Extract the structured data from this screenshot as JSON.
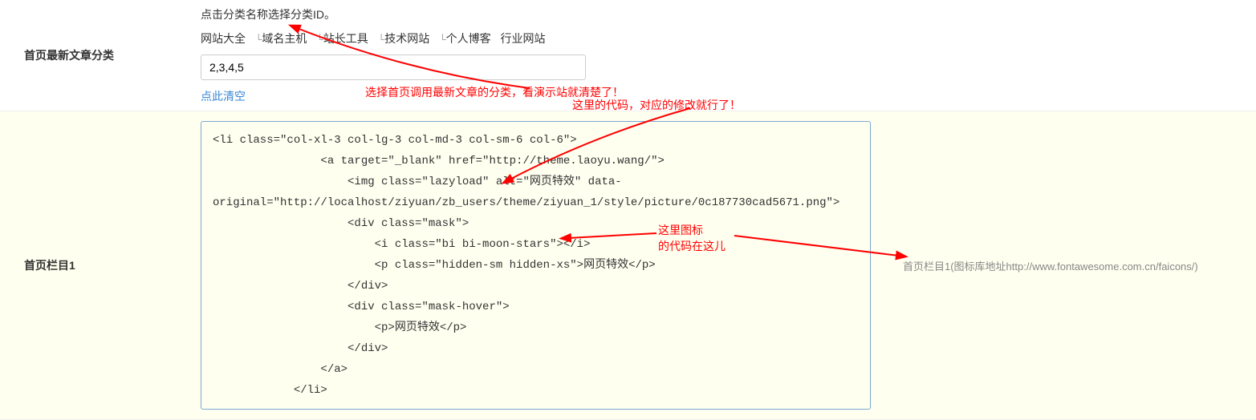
{
  "section1": {
    "label": "首页最新文章分类",
    "hint": "点击分类名称选择分类ID。",
    "categories": [
      {
        "prefix": "",
        "name": "网站大全"
      },
      {
        "prefix": "└",
        "name": "域名主机"
      },
      {
        "prefix": "└",
        "name": "站长工具"
      },
      {
        "prefix": "└",
        "name": "技术网站"
      },
      {
        "prefix": "└",
        "name": "个人博客"
      },
      {
        "prefix": "",
        "name": "行业网站"
      }
    ],
    "input_value": "2,3,4,5",
    "clear_text": "点此清空",
    "annotation1": "选择首页调用最新文章的分类，看演示站就清楚了！"
  },
  "section2": {
    "label": "首页栏目1",
    "right_note": "首页栏目1(图标库地址http://www.fontawesome.com.cn/faicons/)",
    "code": "<li class=\"col-xl-3 col-lg-3 col-md-3 col-sm-6 col-6\">\n                <a target=\"_blank\" href=\"http://theme.laoyu.wang/\">\n                    <img class=\"lazyload\" alt=\"网页特效\" data-\noriginal=\"http://localhost/ziyuan/zb_users/theme/ziyuan_1/style/picture/0c187730cad5671.png\">\n                    <div class=\"mask\">\n                        <i class=\"bi bi-moon-stars\"></i>\n                        <p class=\"hidden-sm hidden-xs\">网页特效</p>\n                    </div>\n                    <div class=\"mask-hover\">\n                        <p>网页特效</p>\n                    </div>\n                </a>\n            </li>",
    "annotation2": "这里的代码，对应的修改就行了！",
    "annotation3_line1": "这里图标",
    "annotation3_line2": "的代码在这儿"
  }
}
